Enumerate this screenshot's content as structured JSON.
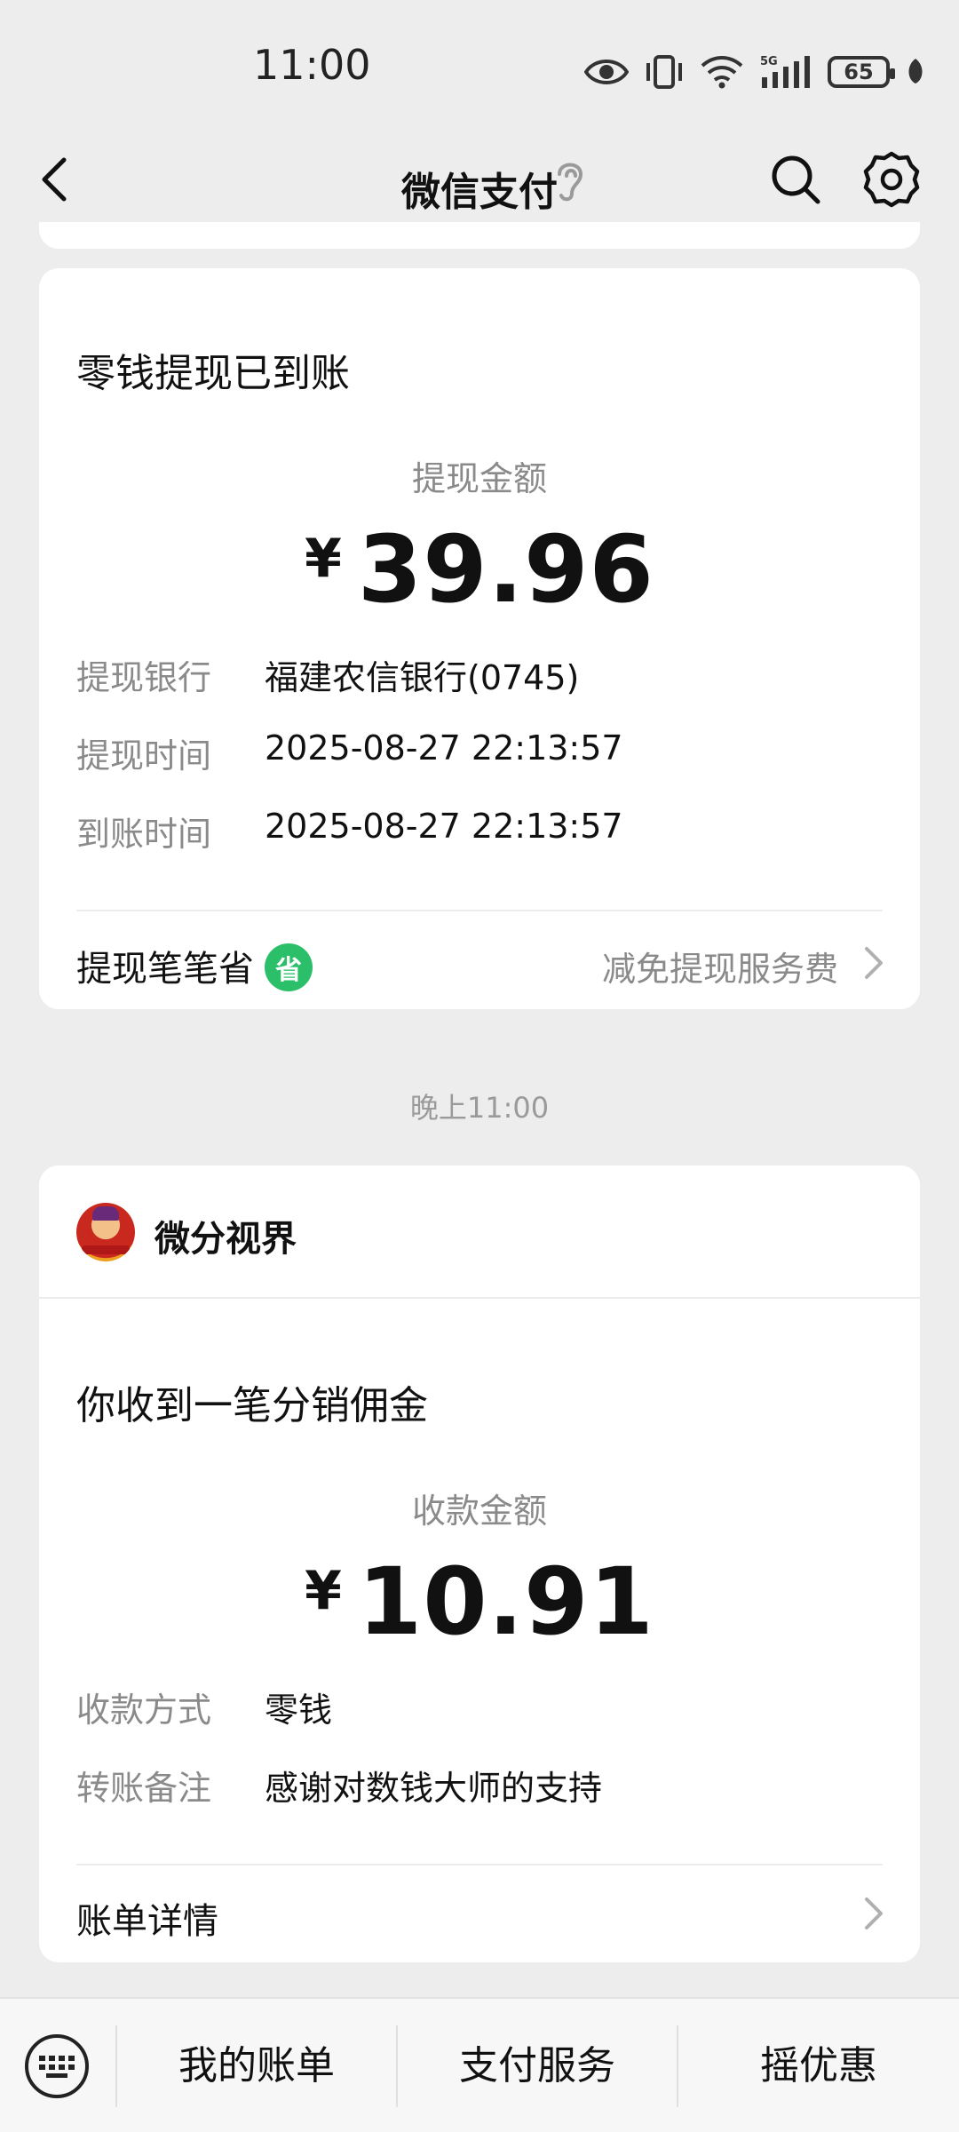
{
  "status_bar": {
    "time": "11:00",
    "battery": "65",
    "icons": [
      "eye-icon",
      "vibrate-icon",
      "wifi-icon",
      "signal-5g-icon",
      "battery-icon",
      "leaf-icon"
    ]
  },
  "nav": {
    "title": "微信支付",
    "icons": [
      "back-icon",
      "ear-icon",
      "search-icon",
      "gear-icon"
    ]
  },
  "withdraw_card": {
    "heading": "零钱提现已到账",
    "amount_label": "提现金额",
    "currency": "¥",
    "amount": "39.96",
    "rows": [
      {
        "label": "提现银行",
        "value": "福建农信银行(0745)"
      },
      {
        "label": "提现时间",
        "value": "2025-08-27 22:13:57"
      },
      {
        "label": "到账时间",
        "value": "2025-08-27 22:13:57"
      }
    ],
    "footer_left": "提现笔笔省",
    "badge": "省",
    "footer_right": "减免提现服务费"
  },
  "time_divider": "晚上11:00",
  "commission_card": {
    "merchant": "微分视界",
    "heading": "你收到一笔分销佣金",
    "amount_label": "收款金额",
    "currency": "¥",
    "amount": "10.91",
    "rows": [
      {
        "label": "收款方式",
        "value": "零钱"
      },
      {
        "label": "转账备注",
        "value": "感谢对数钱大师的支持"
      }
    ],
    "footer": "账单详情"
  },
  "bottom_bar": {
    "items": [
      "我的账单",
      "支付服务",
      "摇优惠"
    ]
  },
  "colors": {
    "background": "#ededed",
    "card": "#ffffff",
    "accent_green": "#2bbf6a",
    "muted_text": "#8a8a8a"
  }
}
